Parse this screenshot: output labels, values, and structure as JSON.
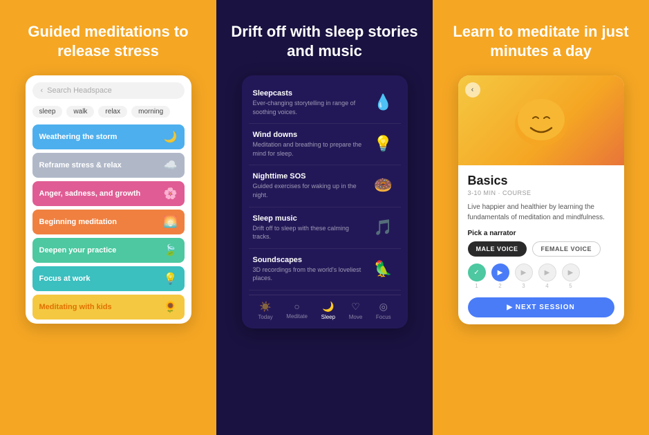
{
  "panels": {
    "left": {
      "heading": "Guided meditations to release stress",
      "search_placeholder": "Search Headspace",
      "tags": [
        "sleep",
        "walk",
        "relax",
        "morning"
      ],
      "items": [
        {
          "label": "Weathering the storm",
          "color": "med-blue",
          "icon": "🌙"
        },
        {
          "label": "Reframe stress & relax",
          "color": "med-gray",
          "icon": "☁️"
        },
        {
          "label": "Anger, sadness, and growth",
          "color": "med-pink",
          "icon": "🌸"
        },
        {
          "label": "Beginning meditation",
          "color": "med-orange",
          "icon": "🌅"
        },
        {
          "label": "Deepen your practice",
          "color": "med-green",
          "icon": "🍃"
        },
        {
          "label": "Focus at work",
          "color": "med-teal",
          "icon": "💡"
        },
        {
          "label": "Meditating with kids",
          "color": "med-yellow",
          "icon": "🌻"
        }
      ]
    },
    "mid": {
      "heading": "Drift off with sleep stories and music",
      "items": [
        {
          "title": "Sleepcasts",
          "desc": "Ever-changing storytelling in range of soothing voices.",
          "icon": "💧"
        },
        {
          "title": "Wind downs",
          "desc": "Meditation and breathing to prepare the mind for sleep.",
          "icon": "💡"
        },
        {
          "title": "Nighttime SOS",
          "desc": "Guided exercises for waking up in the night.",
          "icon": "🍩"
        },
        {
          "title": "Sleep music",
          "desc": "Drift off to sleep with these calming tracks.",
          "icon": "🎵"
        },
        {
          "title": "Soundscapes",
          "desc": "3D recordings from the world's loveliest places.",
          "icon": "🦜"
        }
      ],
      "nav": [
        {
          "label": "Today",
          "icon": "☀️",
          "active": false
        },
        {
          "label": "Meditate",
          "icon": "○",
          "active": false
        },
        {
          "label": "Sleep",
          "icon": "🌙",
          "active": true
        },
        {
          "label": "Move",
          "icon": "♡",
          "active": false
        },
        {
          "label": "Focus",
          "icon": "◎",
          "active": false
        }
      ]
    },
    "right": {
      "heading": "Learn to meditate in just minutes a day",
      "course_title": "Basics",
      "course_meta": "3-10 MIN · COURSE",
      "course_desc": "Live happier and healthier by learning the fundamentals of meditation and mindfulness.",
      "narrator_label": "Pick a narrator",
      "narrator_options": [
        "MALE VOICE",
        "FEMALE VOICE"
      ],
      "active_narrator": 0,
      "sessions": [
        {
          "state": "done-green",
          "num": "1"
        },
        {
          "state": "done-blue",
          "num": "2"
        },
        {
          "state": "pending",
          "num": "3"
        },
        {
          "state": "pending",
          "num": "4"
        },
        {
          "state": "pending",
          "num": "5"
        }
      ],
      "next_btn": "▶  NEXT SESSION",
      "back_label": "‹"
    }
  }
}
